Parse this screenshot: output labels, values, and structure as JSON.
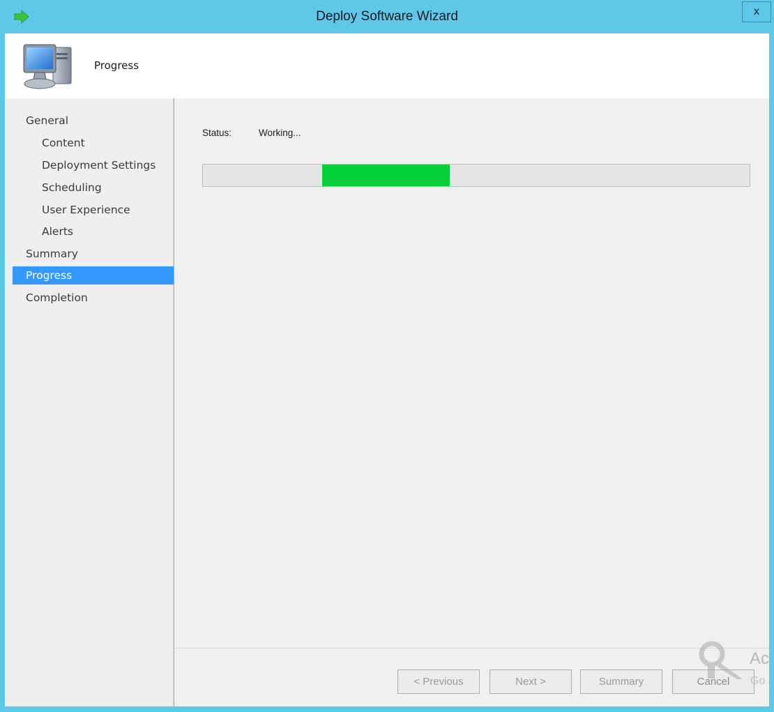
{
  "window": {
    "title": "Deploy Software Wizard",
    "close_label": "x",
    "accent": "#5fc8e8",
    "app_icon": "green-arrow-icon"
  },
  "header": {
    "title": "Progress",
    "icon": "computer-icon"
  },
  "sidebar": {
    "items": [
      {
        "label": "General",
        "level": 0,
        "active": false
      },
      {
        "label": "Content",
        "level": 1,
        "active": false
      },
      {
        "label": "Deployment Settings",
        "level": 1,
        "active": false
      },
      {
        "label": "Scheduling",
        "level": 1,
        "active": false
      },
      {
        "label": "User Experience",
        "level": 1,
        "active": false
      },
      {
        "label": "Alerts",
        "level": 1,
        "active": false
      },
      {
        "label": "Summary",
        "level": 0,
        "active": false
      },
      {
        "label": "Progress",
        "level": 0,
        "active": true
      },
      {
        "label": "Completion",
        "level": 0,
        "active": false
      }
    ],
    "selection_color": "#3399ff"
  },
  "main": {
    "status_label": "Status:",
    "status_value": "Working...",
    "progress": {
      "style": "marquee",
      "fill_color": "#06d03a"
    }
  },
  "footer": {
    "previous_label": "< Previous",
    "next_label": "Next >",
    "summary_label": "Summary",
    "cancel_label": "Cancel"
  },
  "watermark": {
    "line1": "Ac",
    "line2": "Go",
    "icon": "key-icon"
  }
}
